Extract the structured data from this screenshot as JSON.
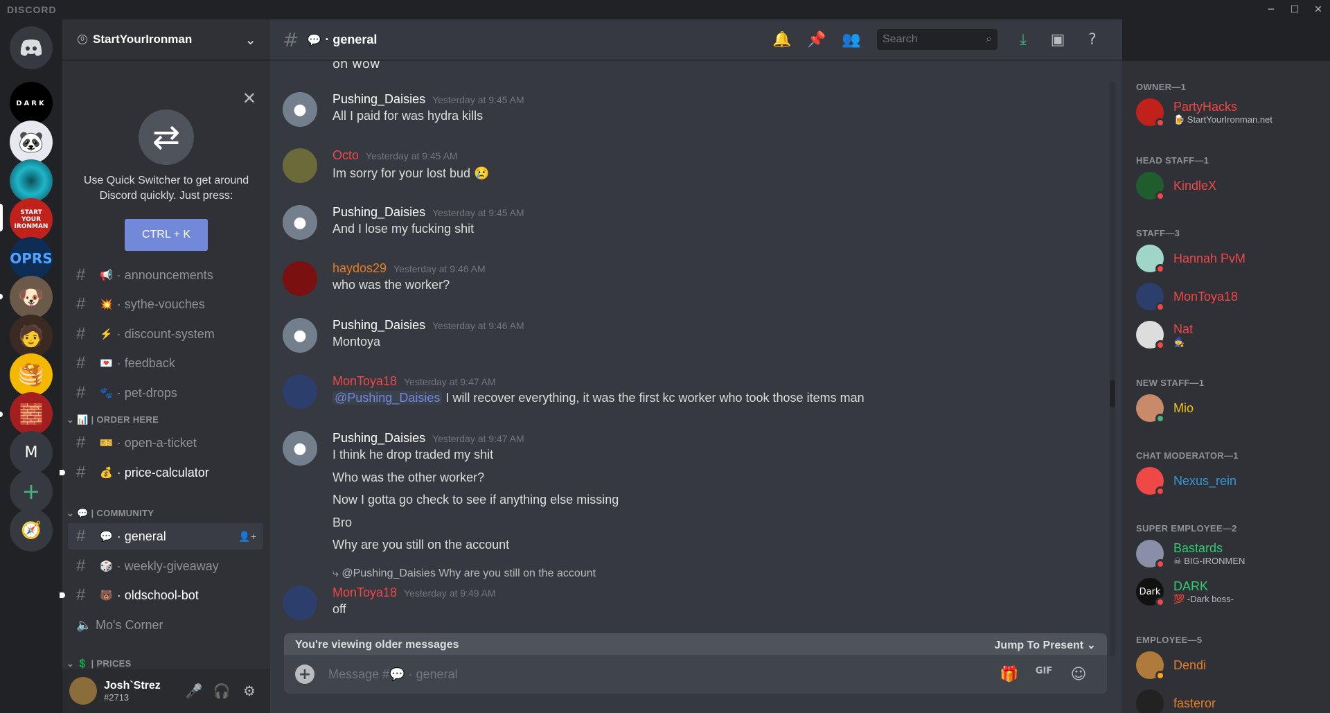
{
  "app": {
    "brand": "DISCORD",
    "minimize": "─",
    "maximize": "☐",
    "close": "✕"
  },
  "servers": {
    "items": [
      {
        "label": "DARK"
      },
      {
        "label": ""
      },
      {
        "label": ""
      },
      {
        "label": "START YOUR IRONMAN"
      },
      {
        "label": "OPRS"
      },
      {
        "label": ""
      },
      {
        "label": ""
      },
      {
        "label": ""
      },
      {
        "label": ""
      },
      {
        "label": "M"
      }
    ],
    "add_label": "+",
    "explore_label": "➤"
  },
  "guild": {
    "name": "StartYourIronman",
    "badge": "0",
    "chevron": "⌄"
  },
  "quick_switcher": {
    "text_line1": "Use Quick Switcher to get around",
    "text_line2": "Discord quickly. Just press:",
    "shortcut": "CTRL + K",
    "close": "✕"
  },
  "channels": [
    {
      "emoji": "📢",
      "name": "announcements"
    },
    {
      "emoji": "💥",
      "name": "sythe-vouches"
    },
    {
      "emoji": "⚡",
      "name": "discount-system"
    },
    {
      "emoji": "💌",
      "name": "feedback"
    },
    {
      "emoji": "🐾",
      "name": "pet-drops"
    }
  ],
  "category_order": {
    "emoji": "📊",
    "name": "| ORDER HERE"
  },
  "order_channels": [
    {
      "emoji": "🎫",
      "name": "open-a-ticket"
    },
    {
      "emoji": "💰",
      "name": "price-calculator"
    }
  ],
  "category_community": {
    "emoji": "💬",
    "name": "| COMMUNITY"
  },
  "community_channels": [
    {
      "emoji": "💬",
      "name": "general"
    },
    {
      "emoji": "🎲",
      "name": "weekly-giveaway"
    },
    {
      "emoji": "🐻",
      "name": "oldschool-bot"
    }
  ],
  "voice_channel": {
    "name": "Mo's Corner"
  },
  "category_prices": {
    "emoji": "💲",
    "name": "| PRICES"
  },
  "user": {
    "name": "Josh`Strez",
    "tag": "#2713",
    "mic": "🎤",
    "headset": "🎧",
    "settings": "⚙"
  },
  "chat": {
    "channel_emoji": "💬",
    "channel_name": "general",
    "search_placeholder": "Search",
    "messages": [
      {
        "author": "Pushing_Daisies",
        "color": "#ffffff",
        "time": "Yesterday at 9:45 AM",
        "lines": [
          "All I paid for was hydra kills"
        ]
      },
      {
        "author": "Octo",
        "color": "#f04747",
        "time": "Yesterday at 9:45 AM",
        "lines": [
          "Im sorry for your lost bud 😢"
        ]
      },
      {
        "author": "Pushing_Daisies",
        "color": "#ffffff",
        "time": "Yesterday at 9:45 AM",
        "lines": [
          "And I lose my fucking shit"
        ]
      },
      {
        "author": "haydos29",
        "color": "#e67e22",
        "time": "Yesterday at 9:46 AM",
        "lines": [
          "who was the worker?"
        ]
      },
      {
        "author": "Pushing_Daisies",
        "color": "#ffffff",
        "time": "Yesterday at 9:46 AM",
        "lines": [
          "Montoya"
        ]
      },
      {
        "author": "MonToya18",
        "color": "#f04747",
        "time": "Yesterday at 9:47 AM",
        "mention": "@Pushing_Daisies",
        "lines": [
          "I will recover everything, it was the first kc worker who took those items man"
        ]
      },
      {
        "author": "Pushing_Daisies",
        "color": "#ffffff",
        "time": "Yesterday at 9:47 AM",
        "lines": [
          "I think he drop traded my shit",
          "Who was the other worker?",
          "Now I gotta go check to see if anything else missing",
          "Bro",
          "Why are you still on the account"
        ]
      },
      {
        "author": "MonToya18",
        "color": "#f04747",
        "time": "Yesterday at 9:49 AM",
        "reply_to": "@Pushing_Daisies",
        "reply_text": "Why are you still on the account",
        "lines": [
          "off"
        ]
      }
    ],
    "partial_top": "oh wow",
    "older_notice": "You're viewing older messages",
    "jump_label": "Jump To Present",
    "composer_placeholder": "Message #💬 · general"
  },
  "members": [
    {
      "role": "OWNER—1",
      "people": [
        {
          "name": "PartyHacks",
          "sub": "🍺 StartYourIronman.net",
          "color": "#f04747"
        }
      ]
    },
    {
      "role": "HEAD STAFF—1",
      "people": [
        {
          "name": "KindleX",
          "sub": "",
          "color": "#f04747"
        }
      ]
    },
    {
      "role": "STAFF—3",
      "people": [
        {
          "name": "Hannah PvM",
          "sub": "",
          "color": "#f04747"
        },
        {
          "name": "MonToya18",
          "sub": "",
          "color": "#f04747"
        },
        {
          "name": "Nat",
          "sub": "🧙",
          "color": "#f04747"
        }
      ]
    },
    {
      "role": "NEW STAFF—1",
      "people": [
        {
          "name": "Mio",
          "sub": "",
          "color": "#f1c40f"
        }
      ]
    },
    {
      "role": "CHAT MODERATOR—1",
      "people": [
        {
          "name": "Nexus_rein",
          "sub": "",
          "color": "#3498db"
        }
      ]
    },
    {
      "role": "SUPER EMPLOYEE—2",
      "people": [
        {
          "name": "Bastards",
          "sub": "☠ BIG-IRONMEN",
          "color": "#2ecc71"
        },
        {
          "name": "DARK",
          "sub": "💯 -Dark boss-",
          "color": "#2ecc71"
        }
      ]
    },
    {
      "role": "EMPLOYEE—5",
      "people": [
        {
          "name": "Dendi",
          "sub": "",
          "color": "#e67e22"
        },
        {
          "name": "fasteror",
          "sub": "",
          "color": "#e67e22"
        }
      ]
    }
  ]
}
